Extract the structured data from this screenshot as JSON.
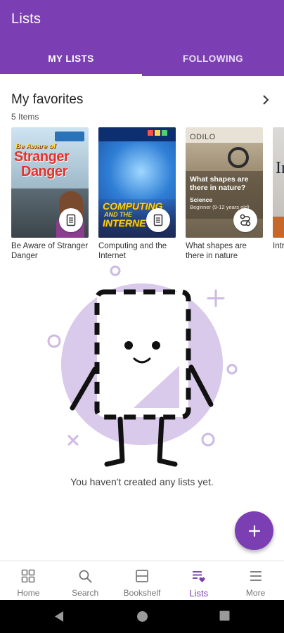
{
  "app": {
    "title": "Lists",
    "accent_color": "#7b3fb3"
  },
  "tabs": [
    {
      "label": "MY LISTS",
      "active": true
    },
    {
      "label": "FOLLOWING",
      "active": false
    }
  ],
  "favorites": {
    "title": "My favorites",
    "count": "5 Items",
    "books": [
      {
        "title": "Be Aware of Stranger Danger",
        "cover": {
          "line1": "Be Aware of",
          "line2": "Stranger",
          "line3": "Danger"
        },
        "type_icon": "document-icon"
      },
      {
        "title": "Computing and the Internet",
        "cover": {
          "line1": "COMPUTING",
          "line2": "AND THE",
          "line3": "INTERNET"
        },
        "type_icon": "document-icon"
      },
      {
        "title": "What shapes are there in nature",
        "cover": {
          "logo": "ODILO",
          "question": "What shapes are there in nature?",
          "subject": "Science",
          "level": "Beginner (9-12 years old)"
        },
        "type_icon": "path-icon"
      },
      {
        "title": "Intro",
        "cover": {
          "text": "In S"
        },
        "type_icon": ""
      }
    ]
  },
  "empty_state": {
    "message": "You haven't created any lists yet."
  },
  "fab": {
    "icon": "plus-icon"
  },
  "bottom_nav": [
    {
      "label": "Home",
      "icon": "grid-icon",
      "active": false
    },
    {
      "label": "Search",
      "icon": "search-icon",
      "active": false
    },
    {
      "label": "Bookshelf",
      "icon": "bookshelf-icon",
      "active": false
    },
    {
      "label": "Lists",
      "icon": "list-heart-icon",
      "active": true
    },
    {
      "label": "More",
      "icon": "menu-icon",
      "active": false
    }
  ],
  "system_nav": [
    "back-icon",
    "home-circle-icon",
    "recents-square-icon"
  ]
}
